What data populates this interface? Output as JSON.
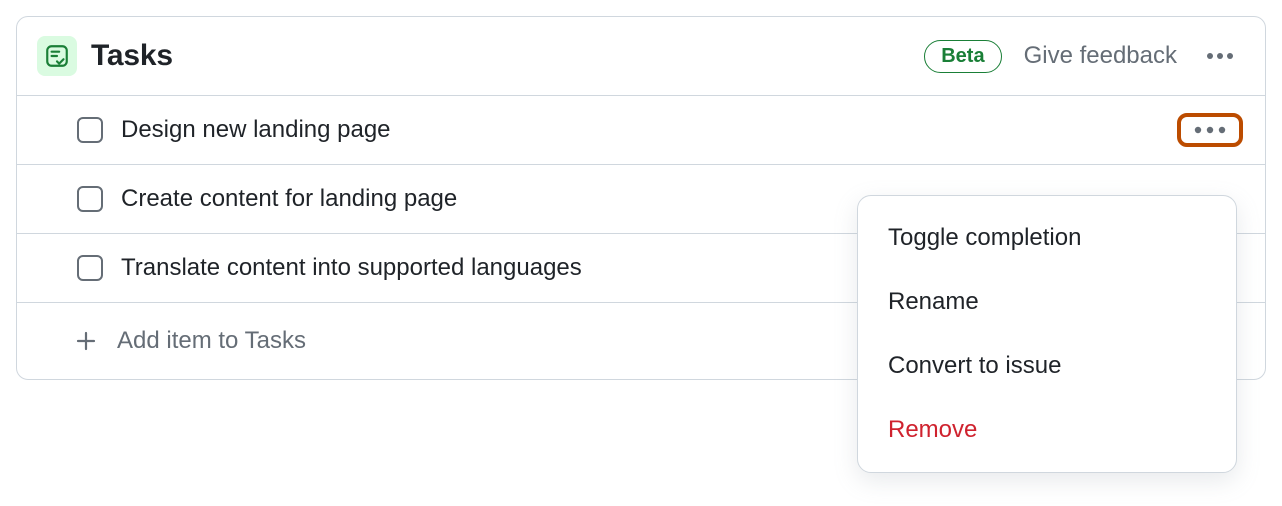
{
  "header": {
    "title": "Tasks",
    "badge": "Beta",
    "feedback": "Give feedback"
  },
  "tasks": [
    {
      "label": "Design new landing page"
    },
    {
      "label": "Create content for landing page"
    },
    {
      "label": "Translate content into supported languages"
    }
  ],
  "addRow": {
    "label": "Add item to Tasks"
  },
  "menu": {
    "toggle": "Toggle completion",
    "rename": "Rename",
    "convert": "Convert to issue",
    "remove": "Remove"
  }
}
